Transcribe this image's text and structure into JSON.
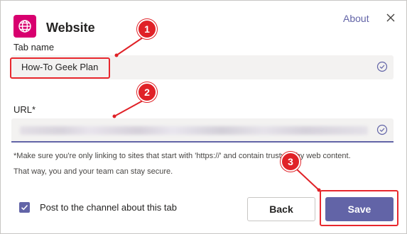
{
  "dialog": {
    "title": "Website",
    "about_label": "About",
    "close_icon": "close-icon",
    "app_icon": "globe-icon",
    "brand_color": "#d8006f",
    "accent_color": "#6264a7"
  },
  "form": {
    "tab_name_label": "Tab name",
    "tab_name_value": "How-To Geek Plan",
    "url_label": "URL*",
    "url_value_blurred": true,
    "valid_icon": "check-circle-icon",
    "hint_line1": "*Make sure you're only linking to sites that start with 'https://' and contain trustworthy web content.",
    "hint_line2": "That way, you and your team can stay secure."
  },
  "footer": {
    "post_to_channel_label": "Post to the channel about this tab",
    "post_to_channel_checked": true,
    "back_label": "Back",
    "save_label": "Save"
  },
  "annotations": {
    "badge1": "1",
    "badge2": "2",
    "badge3": "3",
    "color": "#e02127"
  }
}
